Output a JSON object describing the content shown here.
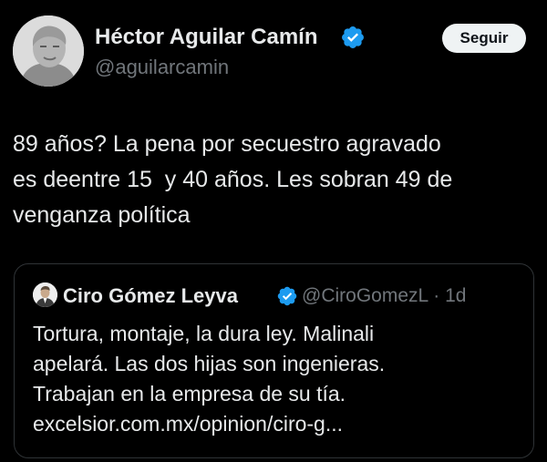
{
  "tweet": {
    "author": {
      "name": "Héctor Aguilar Camín",
      "handle": "@aguilarcamin",
      "verified": true
    },
    "follow_label": "Seguir",
    "text_lines": [
      "89 años? La pena por secuestro agravado",
      "es deentre 15  y 40 años. Les sobran 49 de",
      "venganza política"
    ]
  },
  "quote": {
    "author": {
      "name": "Ciro Gómez Leyva",
      "handle_time": "@CiroGomezL · 1d",
      "verified": true
    },
    "text_lines": [
      "Tortura, montaje, la dura ley. Malinali",
      "apelará. Las dos hijas son ingenieras.",
      "Trabajan en la empresa de su tía.",
      "excelsior.com.mx/opinion/ciro-g..."
    ]
  },
  "colors": {
    "background": "#000000",
    "text_primary": "#e7e9ea",
    "text_secondary": "#71767b",
    "verified_blue": "#1d9bf0",
    "border": "#2f3336",
    "follow_button_bg": "#eff3f4"
  },
  "icons": {
    "verified": "verified-badge-icon"
  }
}
